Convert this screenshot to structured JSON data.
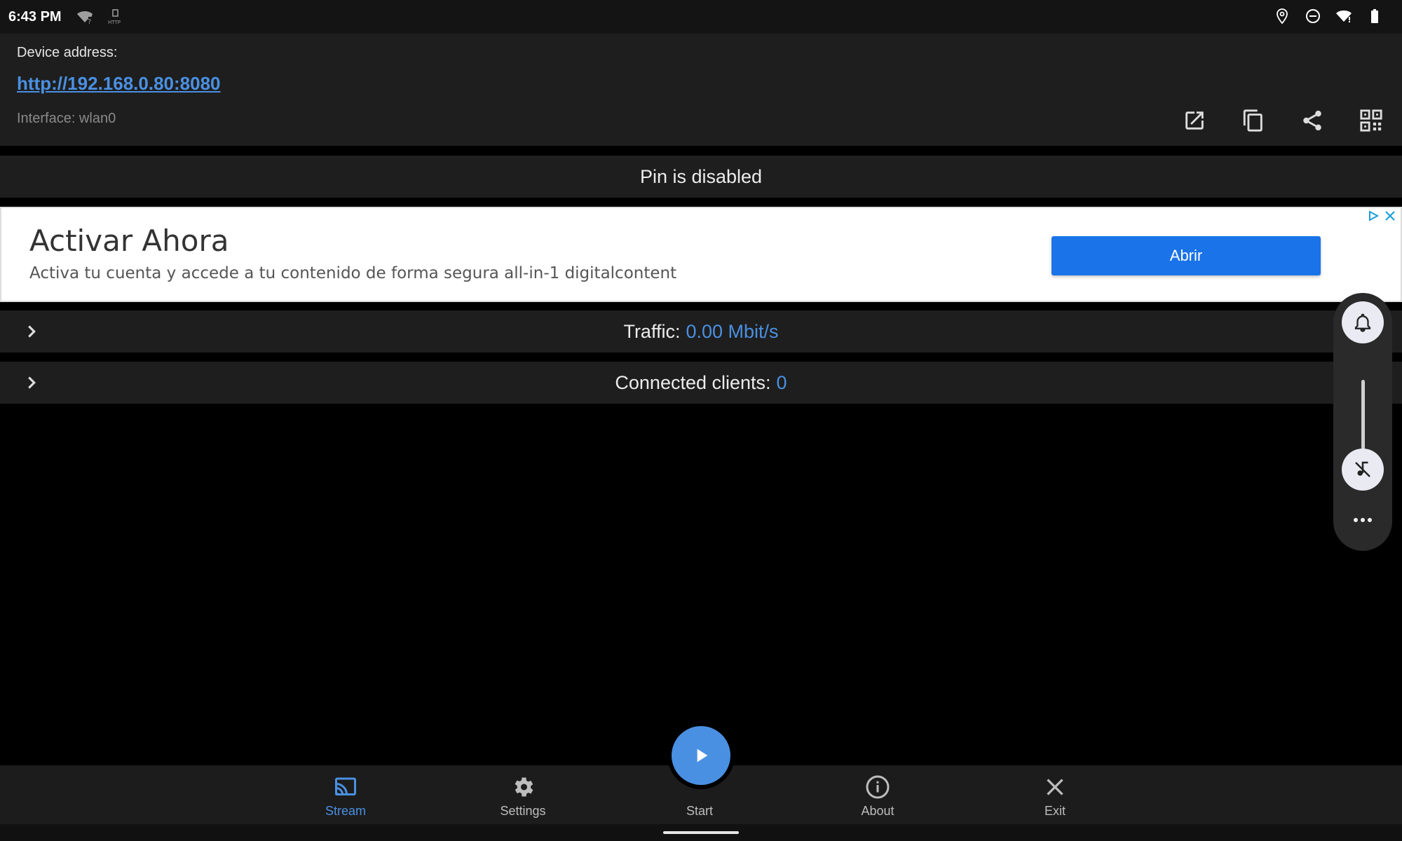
{
  "statusbar": {
    "time": "6:43 PM",
    "left_icons": [
      "wifi-question-icon",
      "http-server-icon"
    ],
    "right_icons": [
      "location-icon",
      "do-not-disturb-icon",
      "wifi-icon",
      "battery-icon"
    ]
  },
  "device": {
    "label": "Device address:",
    "url": "http://192.168.0.80:8080",
    "interface": "Interface: wlan0",
    "actions": [
      "open-in-browser-icon",
      "copy-icon",
      "share-icon",
      "qr-code-icon"
    ]
  },
  "pin": {
    "status": "Pin is disabled"
  },
  "ad": {
    "title": "Activar Ahora",
    "description": "Activa tu cuenta y accede a tu contenido de forma segura all-in-1 digitalcontent",
    "button_label": "Abrir"
  },
  "traffic": {
    "label": "Traffic:",
    "value": "0.00 Mbit/s"
  },
  "clients": {
    "label": "Connected clients:",
    "value": "0"
  },
  "bottom_nav": {
    "stream": "Stream",
    "settings": "Settings",
    "start": "Start",
    "about": "About",
    "exit": "Exit",
    "active": "stream"
  },
  "colors": {
    "accent": "#4a90e2",
    "ad_button": "#1a73e8",
    "card_bg": "#1e1e1e",
    "background": "#000000"
  }
}
